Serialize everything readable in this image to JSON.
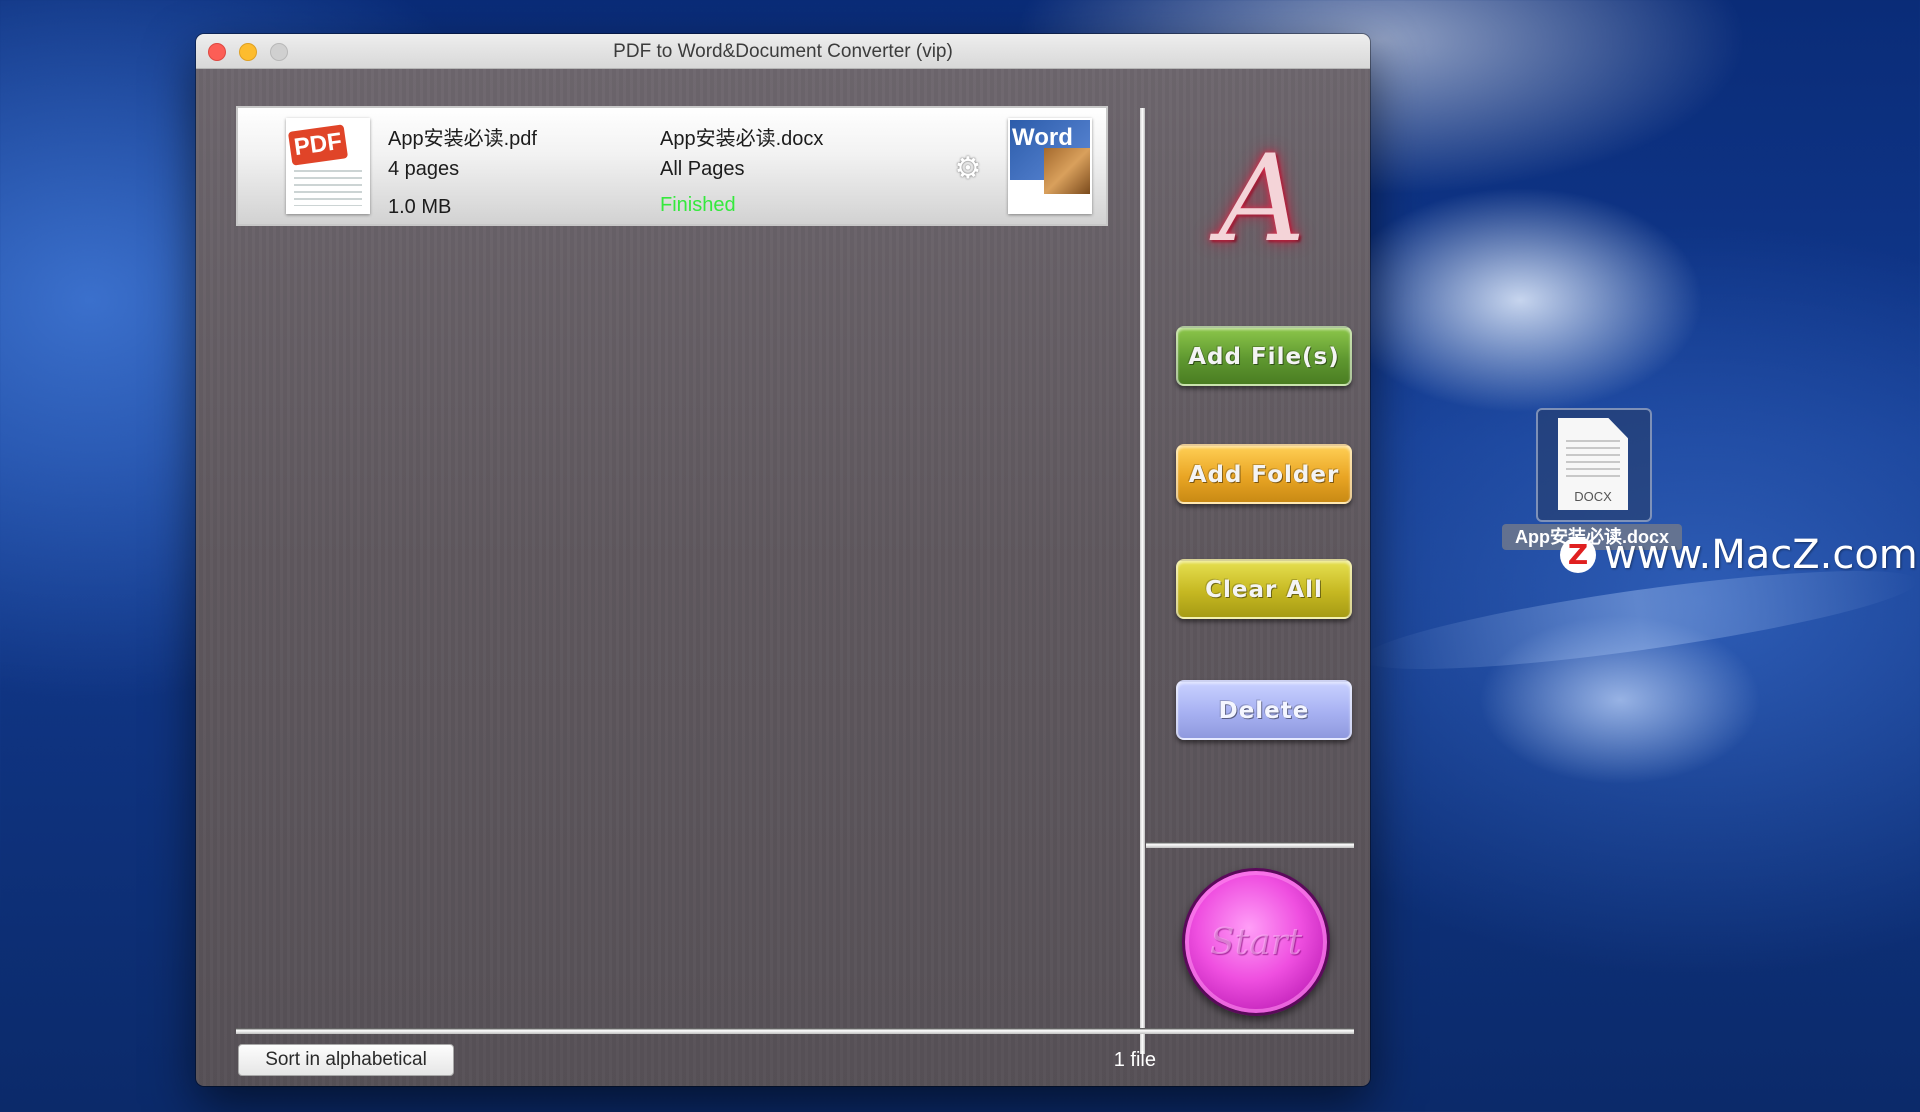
{
  "window": {
    "title": "PDF to Word&Document Converter (vip)"
  },
  "files": [
    {
      "source_name": "App安装必读.pdf",
      "pages": "4 pages",
      "size": "1.0 MB",
      "output_name": "App安装必读.docx",
      "page_range": "All Pages",
      "status": "Finished",
      "source_icon_label": "PDF",
      "output_icon_label": "Word"
    }
  ],
  "logo": {
    "text": "A"
  },
  "sidebar": {
    "add_files": "Add File(s)",
    "add_folder": "Add Folder",
    "clear_all": "Clear All",
    "delete": "Delete",
    "start": "Start"
  },
  "footer": {
    "sort_button": "Sort in alphabetical",
    "file_count": "1 file"
  },
  "desktop": {
    "icon_ext": "DOCX",
    "icon_label": "App安装必读.docx",
    "watermark": "www.MacZ.com",
    "watermark_logo": "Z"
  },
  "colors": {
    "status_finished": "#35e93d",
    "add_files": "#5f9830",
    "add_folder": "#e9a524",
    "clear_all": "#c6b822",
    "delete": "#a7b1f2",
    "start": "#ef4fe0"
  },
  "icons": [
    "close-icon",
    "minimize-icon",
    "zoom-icon",
    "pdf-file-icon",
    "word-file-icon",
    "gear-icon",
    "docx-file-icon"
  ]
}
